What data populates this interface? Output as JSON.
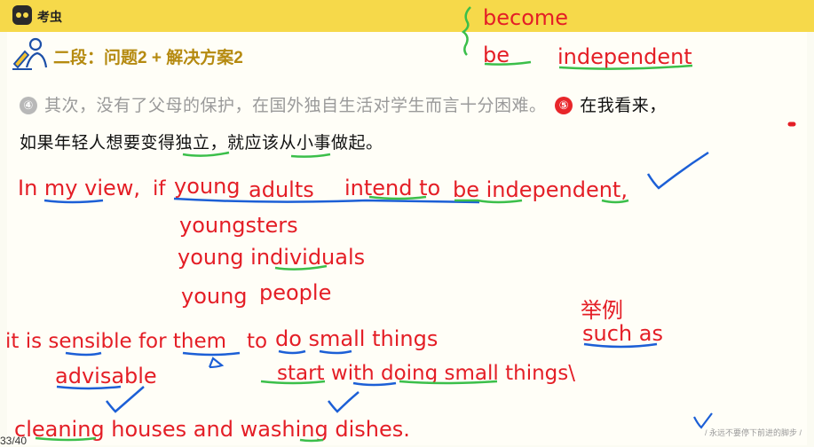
{
  "app": {
    "brand": "考虫"
  },
  "section": {
    "title": "二段：问题2 + 解决方案2"
  },
  "text": {
    "sentence4_num": "④",
    "sentence4": "其次，没有了父母的保护，在国外独自生活对学生而言十分困难。",
    "sentence5_num": "⑤",
    "sentence5_a": "在我看来，",
    "sentence5_b": "如果年轻人想要变得独立，就应该从小事做起。"
  },
  "notes": {
    "become": "become",
    "be": "be",
    "independent": "independent",
    "in_my_view": "In my view,",
    "if": "if",
    "young": "young",
    "adults": "adults",
    "intend_to": "intend to",
    "be_independent": "be independent,",
    "youngsters": "youngsters",
    "young_individuals": "young individuals",
    "young2": "young",
    "people": "people",
    "example_cn": "举例",
    "such_as": "such as",
    "it_is_sensible": "it is sensible for them",
    "to": "to",
    "do_small_things": "do small things",
    "advisable": "advisable",
    "start_with": "start with doing small things\\",
    "cleaning": "cleaning houses and washing dishes."
  },
  "footer": {
    "slogan": "/ 永远不要停下前进的脚步 /",
    "page": "33/40"
  },
  "colors": {
    "topbar": "#f6d94a",
    "ink_red": "#e41e26",
    "ink_blue": "#1c5fd6",
    "ink_green": "#3bbf4a",
    "title_gold": "#b58a10"
  }
}
